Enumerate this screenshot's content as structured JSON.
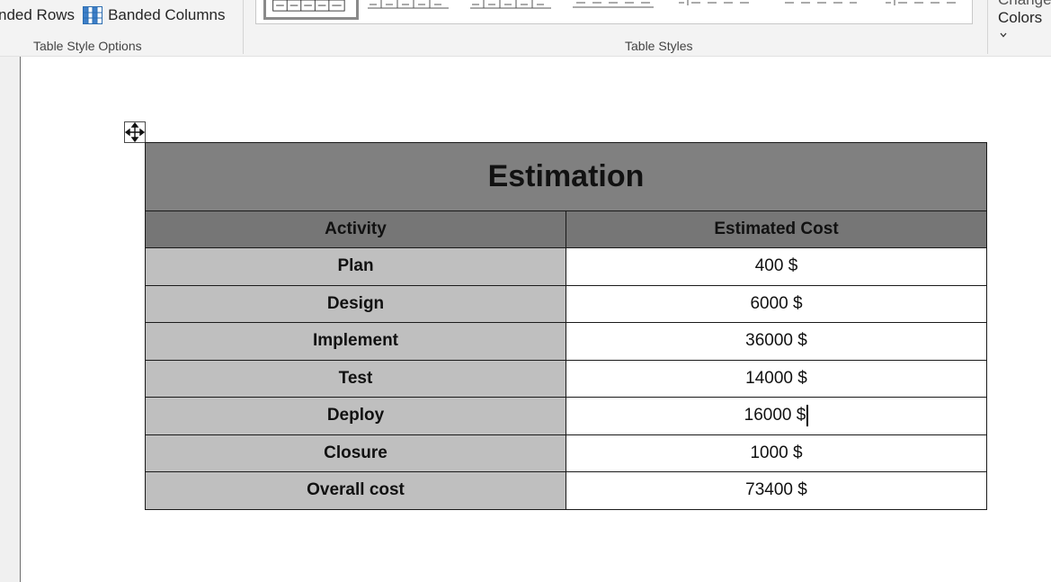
{
  "ribbon": {
    "options": {
      "banded_rows_label": "nded Rows",
      "banded_columns_label": "Banded Columns",
      "group_label": "Table Style Options"
    },
    "styles": {
      "group_label": "Table Styles"
    },
    "colors": {
      "top_label": "Change",
      "bottom_label": "Colors"
    }
  },
  "table": {
    "title": "Estimation",
    "headers": [
      "Activity",
      "Estimated Cost"
    ],
    "rows": [
      {
        "activity": "Plan",
        "cost": "400 $"
      },
      {
        "activity": "Design",
        "cost": "6000 $"
      },
      {
        "activity": "Implement",
        "cost": "36000 $"
      },
      {
        "activity": "Test",
        "cost": "14000 $"
      },
      {
        "activity": "Deploy",
        "cost": "16000 $"
      },
      {
        "activity": "Closure",
        "cost": "1000 $"
      },
      {
        "activity": "Overall cost",
        "cost": "73400 $"
      }
    ]
  },
  "colors": {
    "title_fill": "#808080",
    "header_fill": "#767676",
    "activity_fill": "#bfbfbf",
    "ribbon_bg": "#f3f3f3",
    "banded_icon": "#2b6cb0"
  }
}
